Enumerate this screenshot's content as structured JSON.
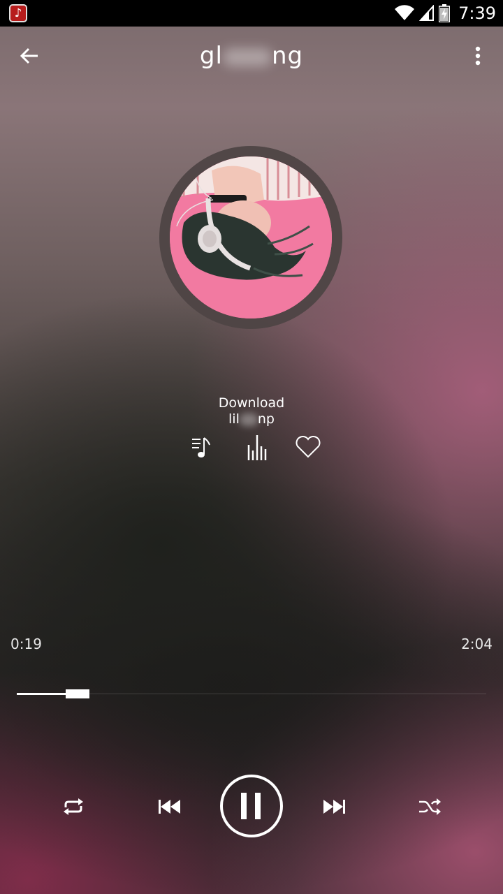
{
  "status_bar": {
    "time": "7:39",
    "app_icon": "music-note-icon",
    "icons": [
      "wifi-icon",
      "signal-icon",
      "battery-charging-icon"
    ]
  },
  "header": {
    "title_start": "g",
    "title_mid": "l",
    "title_end": "ng",
    "back_icon": "arrow-left-icon",
    "more_icon": "more-vert-icon"
  },
  "track": {
    "title": "Download",
    "artist_start": "lil",
    "artist_end": "np"
  },
  "actions": [
    "playlist-icon",
    "equalizer-icon",
    "heart-icon"
  ],
  "player": {
    "elapsed": "0:19",
    "duration": "2:04",
    "progress": 0.155
  },
  "controls": [
    "repeat-icon",
    "previous-icon",
    "pause-icon",
    "next-icon",
    "shuffle-icon"
  ],
  "colors": {
    "accent": "#ffffff",
    "album_bg": "#f27aa1",
    "ring": "#4e4444"
  }
}
